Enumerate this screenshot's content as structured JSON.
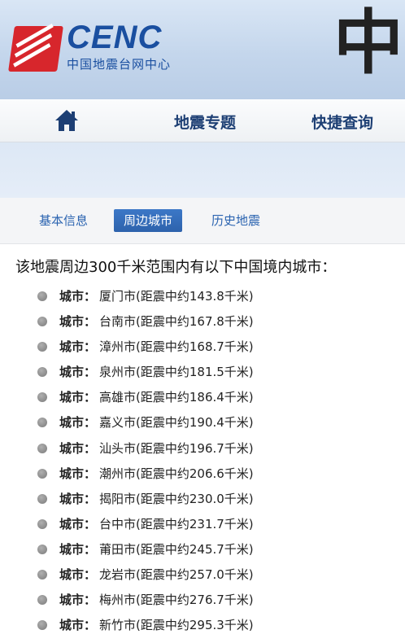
{
  "header": {
    "logo_text": "CENC",
    "logo_subtitle": "中国地震台网中心",
    "calligraphy": "中"
  },
  "nav": {
    "home_icon": "home-icon",
    "items": [
      "地震专题",
      "快捷查询"
    ]
  },
  "tabs": [
    {
      "label": "基本信息",
      "active": false
    },
    {
      "label": "周边城市",
      "active": true
    },
    {
      "label": "历史地震",
      "active": false
    }
  ],
  "intro_text": "该地震周边300千米范围内有以下中国境内城市：",
  "city_label": "城市：",
  "cities": [
    {
      "name": "厦门市(距震中约143.8千米)"
    },
    {
      "name": "台南市(距震中约167.8千米)"
    },
    {
      "name": "漳州市(距震中约168.7千米)"
    },
    {
      "name": "泉州市(距震中约181.5千米)"
    },
    {
      "name": "高雄市(距震中约186.4千米)"
    },
    {
      "name": "嘉义市(距震中约190.4千米)"
    },
    {
      "name": "汕头市(距震中约196.7千米)"
    },
    {
      "name": "潮州市(距震中约206.6千米)"
    },
    {
      "name": "揭阳市(距震中约230.0千米)"
    },
    {
      "name": "台中市(距震中约231.7千米)"
    },
    {
      "name": "莆田市(距震中约245.7千米)"
    },
    {
      "name": "龙岩市(距震中约257.0千米)"
    },
    {
      "name": "梅州市(距震中约276.7千米)"
    },
    {
      "name": "新竹市(距震中约295.3千米)"
    }
  ],
  "colors": {
    "brand_blue": "#1a4fa0",
    "brand_red": "#d7262c",
    "active_tab": "#2d62ac"
  }
}
